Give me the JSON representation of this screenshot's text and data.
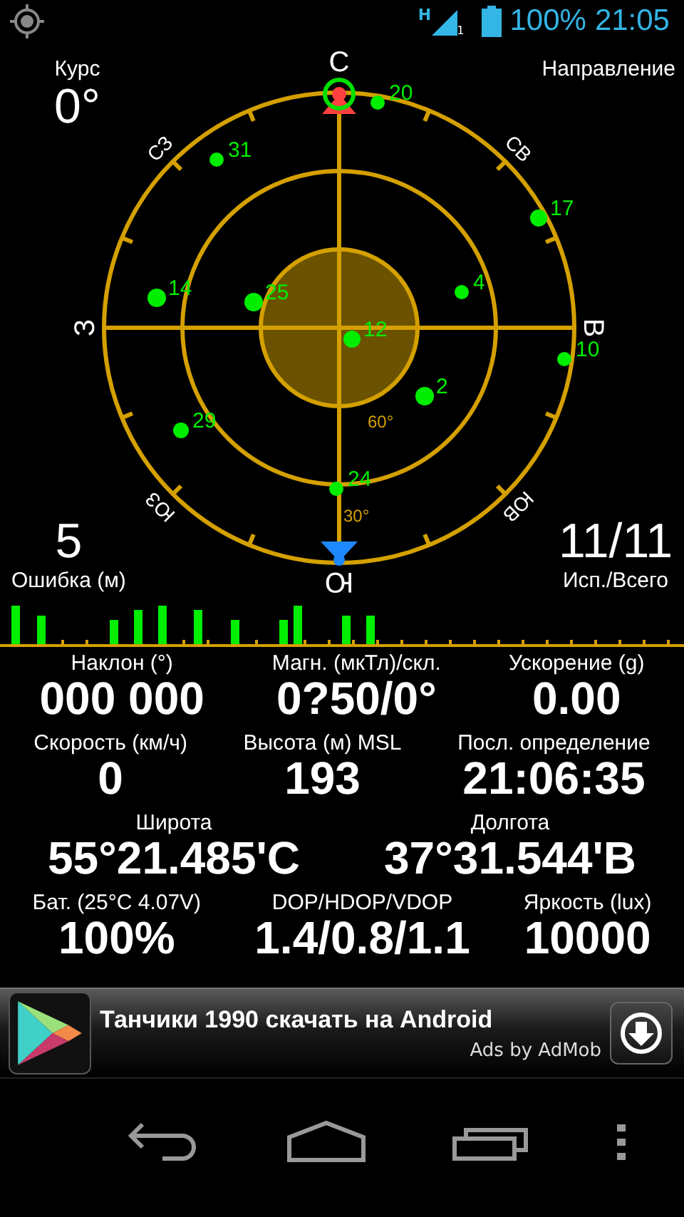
{
  "status_bar": {
    "network": "H",
    "sim": "1",
    "battery": "100%",
    "time": "21:05"
  },
  "course": {
    "label": "Курс",
    "value": "0°"
  },
  "direction": {
    "label": "Направление"
  },
  "error": {
    "value": "5",
    "label": "Ошибка (м)"
  },
  "satellites_count": {
    "value": "11/11",
    "label": "Исп./Всего"
  },
  "radar": {
    "cardinals": [
      "С",
      "СВ",
      "В",
      "ЮВ",
      "Ю",
      "ЮЗ",
      "З",
      "СЗ"
    ],
    "elevation_labels": [
      "60°",
      "30°"
    ],
    "satellites": [
      {
        "prn": "20"
      },
      {
        "prn": "31"
      },
      {
        "prn": "17"
      },
      {
        "prn": "14"
      },
      {
        "prn": "25"
      },
      {
        "prn": "4"
      },
      {
        "prn": "12"
      },
      {
        "prn": "10"
      },
      {
        "prn": "2"
      },
      {
        "prn": "29"
      },
      {
        "prn": "24"
      }
    ]
  },
  "readings": [
    {
      "items": [
        {
          "label": "Наклон (°)",
          "value": "000 000"
        },
        {
          "label": "Магн. (мкТл)/скл.",
          "value": "0?50/0°"
        },
        {
          "label": "Ускорение (g)",
          "value": "0.00"
        }
      ]
    },
    {
      "items": [
        {
          "label": "Скорость (км/ч)",
          "value": "0"
        },
        {
          "label": "Высота (м) MSL",
          "value": "193"
        },
        {
          "label": "Посл. определение",
          "value": "21:06:35"
        }
      ]
    },
    {
      "items": [
        {
          "label": "Широта",
          "value": "55°21.485'С"
        },
        {
          "label": "Долгота",
          "value": "37°31.544'В"
        }
      ]
    },
    {
      "items": [
        {
          "label": "Бат. (25°C 4.07V)",
          "value": "100%"
        },
        {
          "label": "DOP/HDOP/VDOP",
          "value": "1.4/0.8/1.1"
        },
        {
          "label": "Яркость (lux)",
          "value": "10000"
        }
      ]
    }
  ],
  "ad": {
    "title": "Танчики 1990 скачать на Android",
    "source": "Ads by AdMob"
  }
}
